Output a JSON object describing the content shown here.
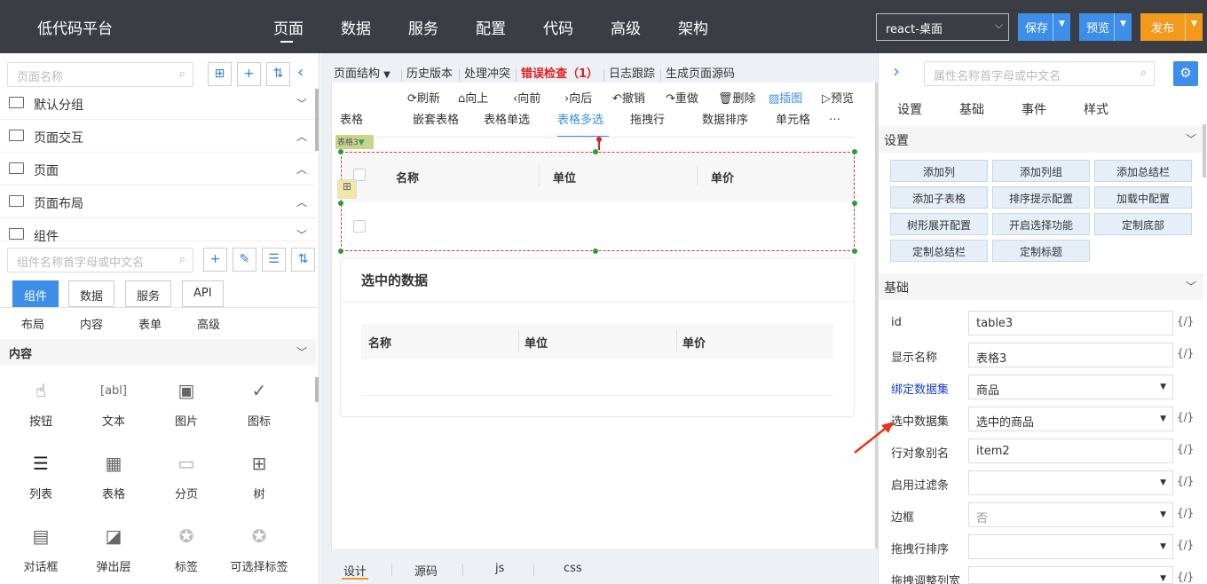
{
  "header": {
    "brand": "低代码平台",
    "nav": [
      "页面",
      "数据",
      "服务",
      "配置",
      "代码",
      "高级",
      "架构"
    ],
    "project": "react-桌面",
    "save": "保存",
    "preview": "预览",
    "publish": "发布",
    "colors": {
      "save": "#3d8ee9",
      "preview": "#3d8ee9",
      "publish": "#f39a1c"
    }
  },
  "left": {
    "page_search_placeholder": "页面名称",
    "groups": [
      "默认分组",
      "页面交互",
      "页面",
      "页面布局",
      "组件"
    ],
    "comp_search_placeholder": "组件名称首字母或中文名",
    "tabs": [
      "组件",
      "数据",
      "服务",
      "API"
    ],
    "subtabs": [
      "布局",
      "内容",
      "表单",
      "高级"
    ],
    "section": "内容",
    "components": [
      "按钮",
      "文本",
      "图片",
      "图标",
      "列表",
      "表格",
      "分页",
      "树",
      "对话框",
      "弹出层",
      "标签",
      "可选择标签"
    ]
  },
  "toolbar": {
    "items": [
      "页面结构",
      "历史版本",
      "处理冲突",
      "错误检查（1）",
      "日志跟踪",
      "生成页面源码"
    ],
    "actions": [
      "刷新",
      "向上",
      "向前",
      "向后",
      "撤销",
      "重做",
      "删除",
      "插图",
      "预览"
    ]
  },
  "canvas": {
    "tabs": [
      "表格",
      "嵌套表格",
      "表格单选",
      "表格多选",
      "拖拽行",
      "数据排序",
      "单元格",
      "…"
    ],
    "tag": "表格3",
    "cols": [
      "名称",
      "单位",
      "单价"
    ],
    "selected_title": "选中的数据",
    "cols2": [
      "名称",
      "单位",
      "单价"
    ],
    "bottom_tabs": [
      "设计",
      "源码",
      "js",
      "css"
    ]
  },
  "right": {
    "search_placeholder": "属性名称首字母或中文名",
    "tabs": [
      "设置",
      "基础",
      "事件",
      "样式"
    ],
    "sec1": "设置",
    "buttons": [
      "添加列",
      "添加列组",
      "添加总结栏",
      "添加子表格",
      "排序提示配置",
      "加载中配置",
      "树形展开配置",
      "开启选择功能",
      "定制底部",
      "定制总结栏",
      "定制标题"
    ],
    "sec2": "基础",
    "props": [
      {
        "label": "id",
        "value": "table3"
      },
      {
        "label": "显示名称",
        "value": "表格3"
      },
      {
        "label": "绑定数据集",
        "value": "商品"
      },
      {
        "label": "选中数据集",
        "value": "选中的商品"
      },
      {
        "label": "行对象别名",
        "value": "item2"
      },
      {
        "label": "启用过滤条",
        "value": ""
      },
      {
        "label": "边框",
        "value": "否"
      },
      {
        "label": "拖拽行排序",
        "value": ""
      },
      {
        "label": "拖拽调整列宽",
        "value": ""
      }
    ],
    "fx": "{/}"
  }
}
